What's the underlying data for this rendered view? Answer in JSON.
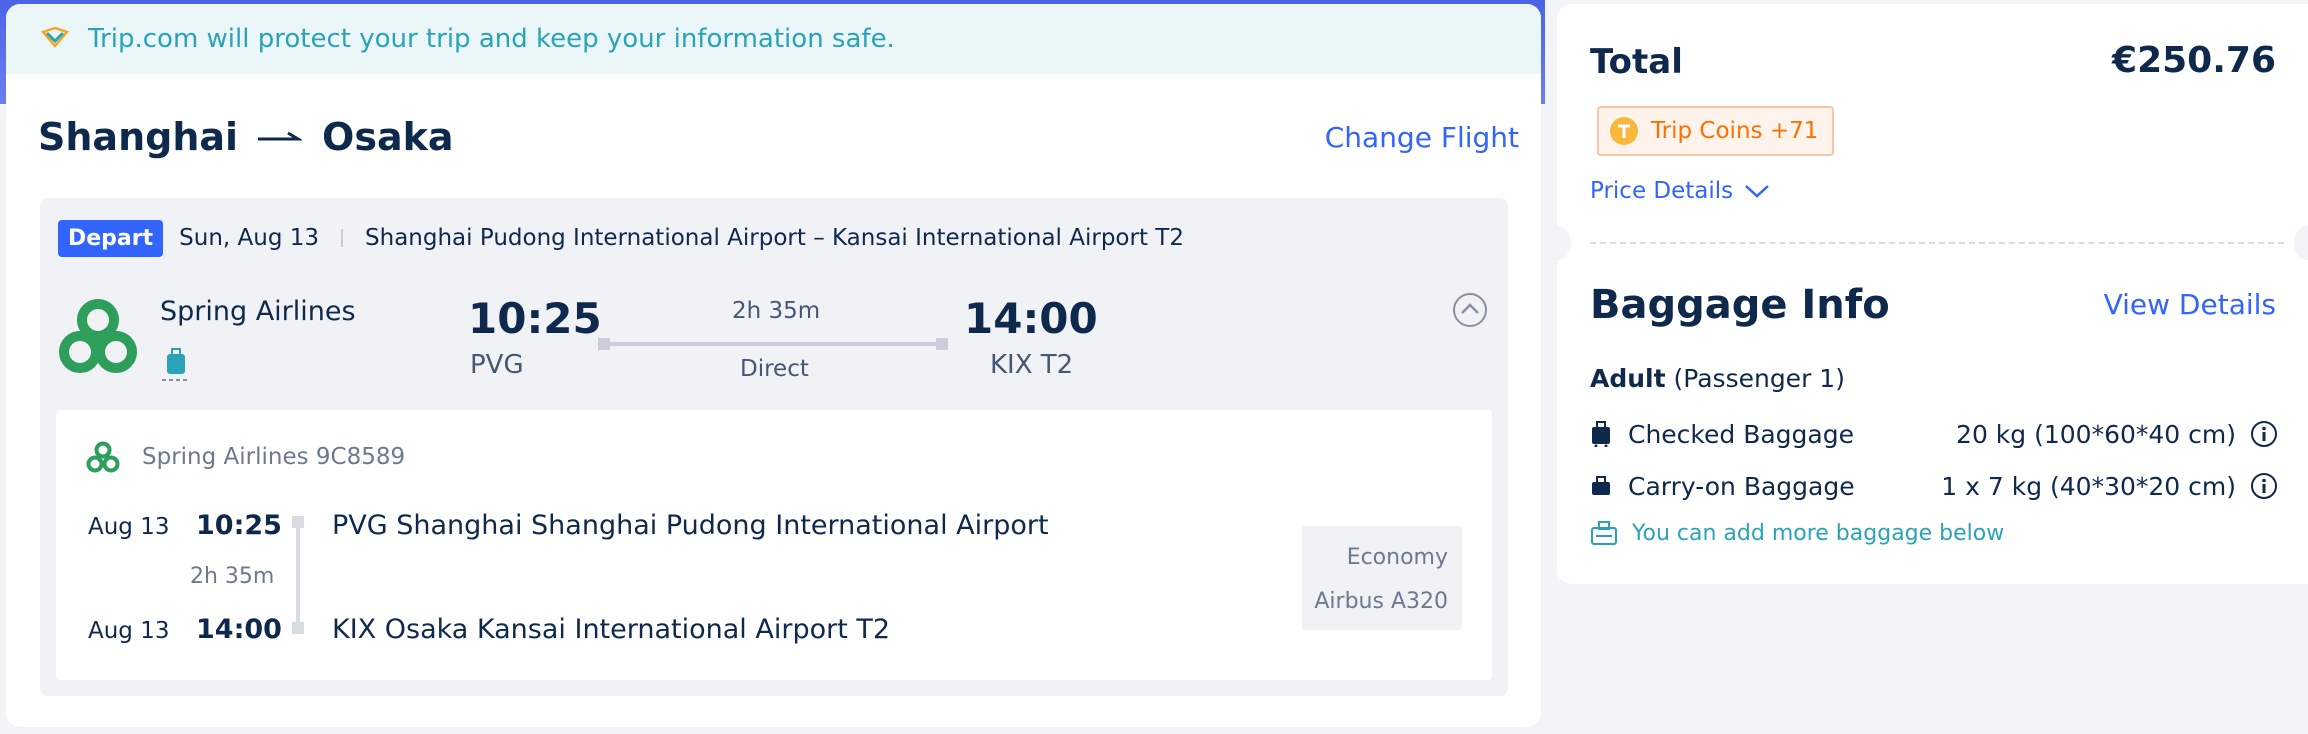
{
  "banner": {
    "protect_text": "Trip.com will protect your trip and keep your information safe.",
    "icon": "shield-check-icon"
  },
  "route": {
    "origin": "Shanghai",
    "destination": "Osaka",
    "change_flight_label": "Change Flight"
  },
  "flight": {
    "badge": "Depart",
    "date": "Sun, Aug 13",
    "airports_summary": "Shanghai Pudong International Airport – Kansai International Airport T2",
    "airline": "Spring Airlines",
    "dep_time": "10:25",
    "dep_code": "PVG",
    "duration": "2h 35m",
    "stops": "Direct",
    "arr_time": "14:00",
    "arr_code": "KIX T2"
  },
  "details": {
    "airline_flight": "Spring Airlines 9C8589",
    "dep_date": "Aug 13",
    "dep_time": "10:25",
    "duration": "2h 35m",
    "arr_date": "Aug 13",
    "arr_time": "14:00",
    "dep_airport": "PVG Shanghai Shanghai Pudong International Airport",
    "arr_airport": "KIX Osaka Kansai International Airport T2",
    "cabin": "Economy",
    "aircraft": "Airbus A320"
  },
  "summary": {
    "total_label": "Total",
    "total_value": "€250.76",
    "coins_label": "Trip Coins +71",
    "price_details_label": "Price Details"
  },
  "baggage": {
    "title": "Baggage Info",
    "view_details_label": "View Details",
    "passenger_type": "Adult",
    "passenger_note": "(Passenger 1)",
    "checked_label": "Checked Baggage",
    "checked_value": "20 kg (100*60*40 cm)",
    "carry_label": "Carry-on Baggage",
    "carry_value": "1 x 7 kg (40*30*20 cm)",
    "add_more_text": "You can add more baggage below"
  },
  "colors": {
    "brand_blue": "#3264ff",
    "teal": "#2aa3b8",
    "airline_green": "#2e9e5b",
    "coin_orange": "#ff6f00"
  }
}
